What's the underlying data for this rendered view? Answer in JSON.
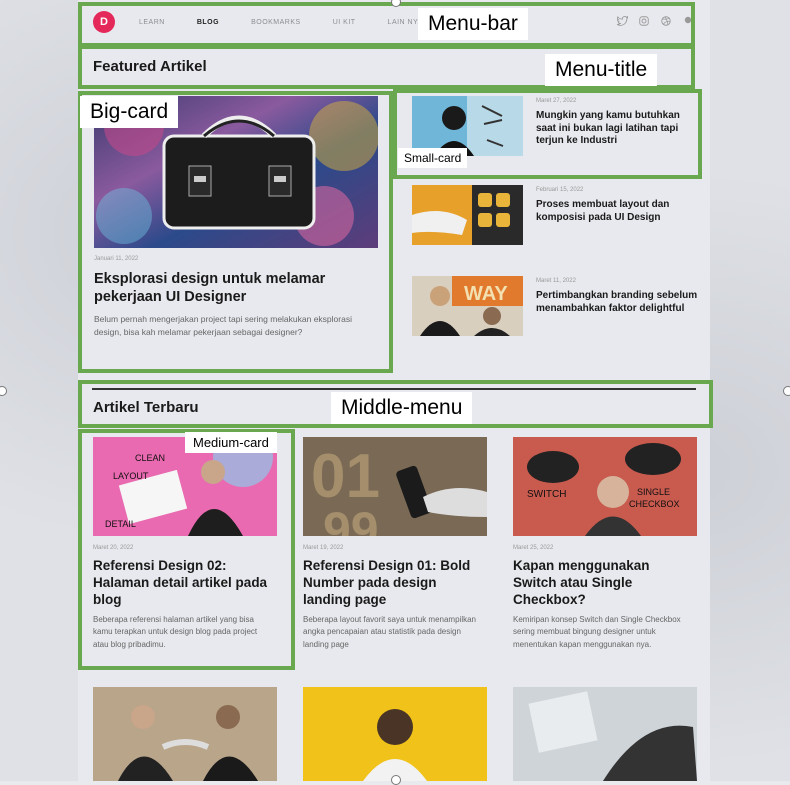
{
  "nav": {
    "logo_letter": "D",
    "items": [
      "LEARN",
      "BLOG",
      "BOOKMARKS",
      "UI KIT",
      "LAIN NYA"
    ],
    "active": "BLOG",
    "icons": [
      "twitter-icon",
      "instagram-icon",
      "dribbble-icon",
      "more-icon"
    ]
  },
  "featured": {
    "heading": "Featured Artikel",
    "big": {
      "date": "Januari 11, 2022",
      "title": "Eksplorasi design untuk melamar pekerjaan UI Designer",
      "desc": "Belum pernah mengerjakan project tapi sering melakukan eksplorasi design, bisa kah melamar pekerjaan sebagai designer?"
    },
    "small": [
      {
        "date": "Maret 27, 2022",
        "title": "Mungkin yang kamu butuhkan saat ini bukan lagi latihan tapi terjun ke Industri"
      },
      {
        "date": "Februari 15, 2022",
        "title": "Proses membuat layout dan komposisi pada UI Design"
      },
      {
        "date": "Maret 11, 2022",
        "title": "Pertimbangkan branding sebelum menambahkan faktor delightful"
      }
    ]
  },
  "latest": {
    "heading": "Artikel Terbaru",
    "cards": [
      {
        "date": "Maret 20, 2022",
        "title": "Referensi Design 02: Halaman detail artikel pada blog",
        "desc": "Beberapa referensi halaman artikel yang bisa kamu terapkan untuk design blog pada project atau blog pribadimu."
      },
      {
        "date": "Maret 19, 2022",
        "title": "Referensi Design 01: Bold Number pada design landing page",
        "desc": "Beberapa layout favorit saya untuk menampilkan angka pencapaian atau statistik pada design landing page"
      },
      {
        "date": "Maret 25, 2022",
        "title": "Kapan menggunakan Switch atau Single Checkbox?",
        "desc": "Kemiripan konsep Switch dan Single Checkbox sering membuat bingung designer untuk menentukan kapan menggunakan nya."
      }
    ]
  },
  "annotations": {
    "menu_bar": "Menu-bar",
    "menu_title": "Menu-title",
    "big_card": "Big-card",
    "small_card": "Small-card",
    "middle_menu": "Middle-menu",
    "medium_card": "Medium-card"
  },
  "colors": {
    "annotation": "#6aa84f",
    "logo": "#e5285a"
  }
}
